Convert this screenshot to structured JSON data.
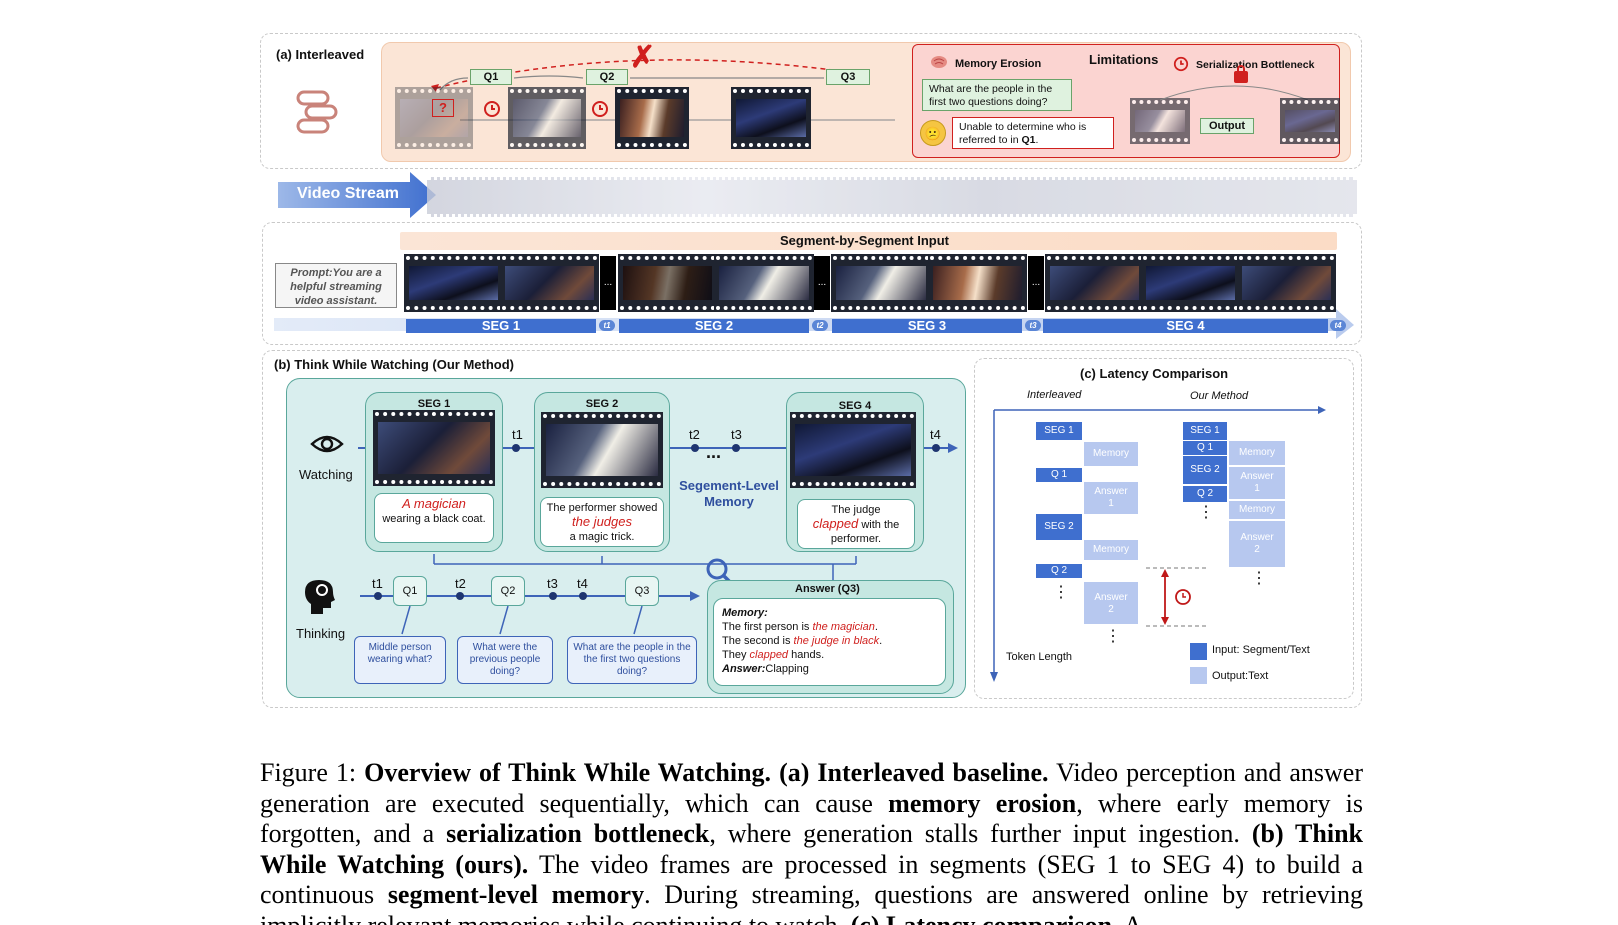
{
  "panel_a": {
    "title": "(a) Interleaved",
    "q_labels": [
      "Q1",
      "Q2",
      "Q3"
    ],
    "limitations_title": "Limitations",
    "memory_erosion_label": "Memory Erosion",
    "serialization_label": "Serialization Bottleneck",
    "question_text": "What are the people in the first two questions doing?",
    "answer_text_1": "Unable to determine who is referred to in ",
    "answer_text_q": "Q1",
    "answer_text_2": ".",
    "output_label": "Output",
    "cross_mark": "✗"
  },
  "video_stream": {
    "label": "Video Stream"
  },
  "segments": {
    "header": "Segment-by-Segment Input",
    "prompt": "Prompt:You are a helpful streaming video assistant.",
    "seg_labels": [
      "SEG 1",
      "SEG 2",
      "SEG 3",
      "SEG 4"
    ],
    "t_labels": [
      "t1",
      "t2",
      "t3",
      "t4"
    ],
    "ellipsis": "..."
  },
  "panel_b": {
    "title": "(b) Think While Watching (Our Method)",
    "watching_label": "Watching",
    "thinking_label": "Thinking",
    "seg_card_titles": [
      "SEG 1",
      "SEG 2",
      "SEG 4"
    ],
    "seg1_caption_red": "A magician",
    "seg1_caption_rest": "wearing a black coat.",
    "seg2_caption_a": "The  performer showed ",
    "seg2_caption_red": "the judges",
    "seg2_caption_b": "a magic trick.",
    "seg4_caption_a": "The judge",
    "seg4_caption_red": "clapped",
    "seg4_caption_b": " with the performer.",
    "memory_label": "Segement-Level Memory",
    "timeline_t": [
      "t1",
      "t2",
      "t3",
      "t4"
    ],
    "dots": "...",
    "q_nodes": [
      "Q1",
      "Q2",
      "Q3"
    ],
    "think_t": [
      "t1",
      "t2",
      "t3",
      "t4"
    ],
    "questions": [
      "Middle person wearing what?",
      "What were the previous people doing?",
      "What are the people in the the first two questions doing?"
    ],
    "answer_title": "Answer  (Q3)",
    "answer_memory_label": "Memory:",
    "answer_line1_a": "The first person is ",
    "answer_line1_red": "the magician",
    "answer_line1_b": ".",
    "answer_line2_a": "The second is ",
    "answer_line2_red": "the judge in black",
    "answer_line2_b": ".",
    "answer_line3_a": "They ",
    "answer_line3_red": "clapped",
    "answer_line3_b": " hands.",
    "answer_final_label": "Answer:",
    "answer_final_value": "Clapping"
  },
  "panel_c": {
    "title": "(c)  Latency Comparison",
    "col_interleaved": "Interleaved",
    "col_ours": "Our Method",
    "axis_label": "Token Length",
    "legend_input": "Input: Segment/Text",
    "legend_output": "Output:Text",
    "blocks_left": [
      "SEG 1",
      "Memory",
      "Q 1",
      "Answer 1",
      "SEG 2",
      "Memory",
      "Q 2",
      "Answer 2"
    ],
    "blocks_right": [
      "SEG 1",
      "Q 1",
      "Memory",
      "SEG 2",
      "Answer 1",
      "Q 2",
      "Memory",
      "Answer 2"
    ],
    "vdots": "⋮",
    "colors": {
      "input": "#3f6fcf",
      "output": "#b7c8ef"
    }
  },
  "caption": {
    "figure_label": "Figure 1:",
    "title_bold": "Overview of Think While Watching.",
    "part_a_bold": "(a) Interleaved baseline.",
    "text_1": "Video perception and answer generation are executed sequentially, which can cause ",
    "memory_erosion_bold": "memory erosion",
    "text_2": ", where early memory is forgotten, and a ",
    "serialization_bold": "serialization bottleneck",
    "text_3": ", where generation stalls further input ingestion. ",
    "part_b_bold": "(b) Think While Watching (ours).",
    "text_4": " The video frames are processed in segments (SEG 1 to SEG 4) to build a continuous ",
    "segment_memory_bold": "segment-level memory",
    "text_5": ". During streaming, questions are answered online by retrieving implicitly relevant memories while continuing to watch. ",
    "part_c_bold": "(c) Latency comparison.",
    "text_6": " A"
  }
}
